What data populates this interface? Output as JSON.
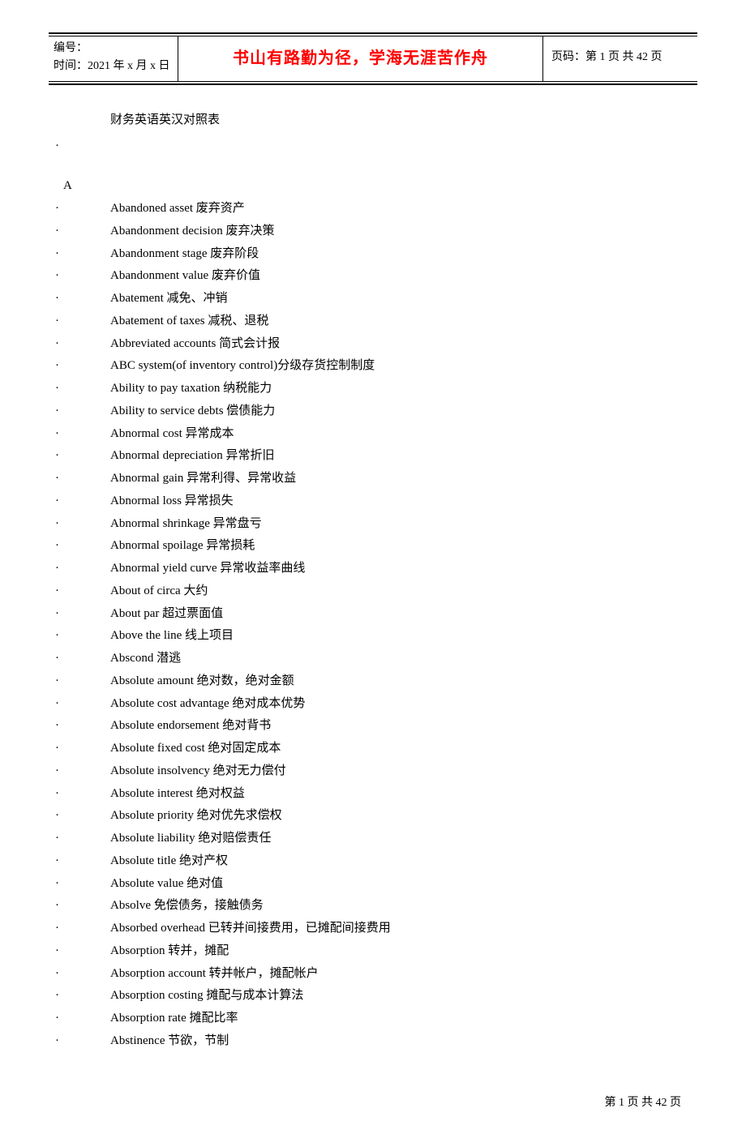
{
  "header": {
    "id_label": "编号：",
    "time_label": "时间：2021 年 x 月 x 日",
    "motto": "书山有路勤为径，学海无涯苦作舟",
    "page_label": "页码：第 1 页  共 42 页"
  },
  "title": "财务英语英汉对照表",
  "dot": "·",
  "section": "A",
  "entries": [
    "Abandoned asset  废弃资产",
    "Abandonment decision  废弃决策",
    "Abandonment stage  废弃阶段",
    "Abandonment value  废弃价值",
    "Abatement  减免、冲销",
    "Abatement of taxes  减税、退税",
    "Abbreviated accounts  简式会计报",
    "ABC system(of inventory control)分级存货控制制度",
    "Ability to pay taxation  纳税能力",
    "Ability to service debts  偿债能力",
    "Abnormal cost  异常成本",
    "Abnormal depreciation  异常折旧",
    "Abnormal gain  异常利得、异常收益",
    "Abnormal loss  异常损失",
    "Abnormal shrinkage  异常盘亏",
    "Abnormal spoilage  异常损耗",
    "Abnormal yield curve  异常收益率曲线",
    "About of circa  大约",
    "About par  超过票面值",
    "Above the line  线上项目",
    "Abscond  潜逃",
    "Absolute amount  绝对数，绝对金额",
    "Absolute cost advantage  绝对成本优势",
    "Absolute endorsement  绝对背书",
    "Absolute fixed cost  绝对固定成本",
    "Absolute insolvency  绝对无力偿付",
    "Absolute interest  绝对权益",
    "Absolute priority  绝对优先求偿权",
    "Absolute liability  绝对赔偿责任",
    "Absolute title  绝对产权",
    "Absolute value  绝对值",
    "Absolve 免偿债务，接触债务",
    "Absorbed overhead  已转并间接费用，已摊配间接费用",
    "Absorption  转并，摊配",
    "Absorption account  转并帐户，摊配帐户",
    "Absorption costing  摊配与成本计算法",
    "Absorption rate  摊配比率",
    "Abstinence  节欲，节制"
  ],
  "footer": "第  1  页  共  42  页"
}
